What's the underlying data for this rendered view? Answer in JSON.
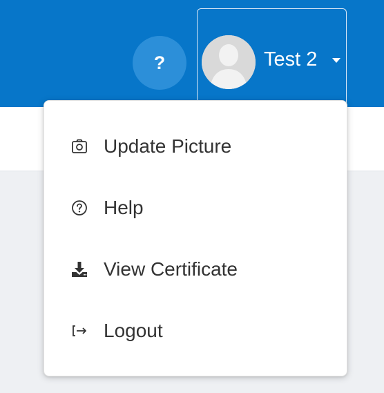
{
  "header": {
    "help_button_label": "?",
    "help_icon": "question-mark-icon",
    "user": {
      "name": "Test 2",
      "avatar_icon": "user-silhouette-icon",
      "caret_icon": "caret-down-icon"
    }
  },
  "user_menu": {
    "items": [
      {
        "label": "Update Picture",
        "icon": "camera-icon"
      },
      {
        "label": "Help",
        "icon": "help-circle-icon"
      },
      {
        "label": "View Certificate",
        "icon": "download-icon"
      },
      {
        "label": "Logout",
        "icon": "logout-icon"
      }
    ]
  },
  "colors": {
    "header_bg": "#0776c9",
    "help_button_bg": "#2c8fd9",
    "menu_text": "#333333",
    "page_bg": "#eef0f3"
  }
}
